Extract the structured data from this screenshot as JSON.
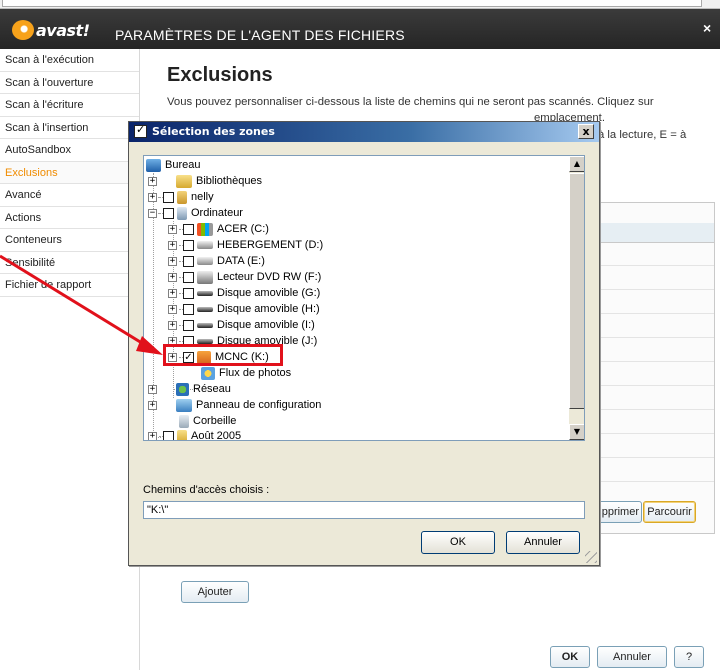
{
  "window": {
    "logo_text": "avast!",
    "title": "PARAMÈTRES DE L'AGENT DES FICHIERS",
    "close": "×"
  },
  "sidebar": {
    "items": [
      {
        "label": "Scan à l'exécution",
        "active": false
      },
      {
        "label": "Scan à l'ouverture",
        "active": false
      },
      {
        "label": "Scan à l'écriture",
        "active": false
      },
      {
        "label": "Scan à l'insertion",
        "active": false
      },
      {
        "label": "AutoSandbox",
        "active": false
      },
      {
        "label": "Exclusions",
        "active": true
      },
      {
        "label": "Avancé",
        "active": false
      },
      {
        "label": "Actions",
        "active": false
      },
      {
        "label": "Conteneurs",
        "active": false
      },
      {
        "label": "Sensibilité",
        "active": false
      },
      {
        "label": "Fichier de rapport",
        "active": false
      }
    ],
    "active_color": "#f08c00"
  },
  "main": {
    "heading": "Exclusions",
    "desc_line1": "Vous pouvez personnaliser ci-dessous la liste de chemins qui ne seront pas scannés. Cliquez sur",
    "desc_line2_fragment": "emplacement.",
    "desc_line3_fragment": "à la lecture, E = à",
    "buttons": {
      "supprimer": "pprimer",
      "parcourir": "Parcourir",
      "ajouter": "Ajouter",
      "ok": "OK",
      "annuler": "Annuler",
      "help": "?"
    }
  },
  "dialog": {
    "title": "Sélection des zones",
    "close": "x",
    "tree": [
      {
        "label": "Bureau",
        "icon": "desktop-icon"
      },
      {
        "label": "Bibliothèques",
        "icon": "libraries-icon"
      },
      {
        "label": "nelly",
        "icon": "user-folder-icon"
      },
      {
        "label": "Ordinateur",
        "icon": "computer-icon"
      },
      {
        "label": "ACER (C:)",
        "icon": "windows-drive-icon"
      },
      {
        "label": "HEBERGEMENT (D:)",
        "icon": "hard-drive-icon"
      },
      {
        "label": "DATA (E:)",
        "icon": "hard-drive-icon"
      },
      {
        "label": "Lecteur DVD RW (F:)",
        "icon": "dvd-drive-icon"
      },
      {
        "label": "Disque amovible (G:)",
        "icon": "removable-drive-icon"
      },
      {
        "label": "Disque amovible (H:)",
        "icon": "removable-drive-icon"
      },
      {
        "label": "Disque amovible (I:)",
        "icon": "removable-drive-icon"
      },
      {
        "label": "Disque amovible (J:)",
        "icon": "removable-drive-icon"
      },
      {
        "label": "MCNC (K:)",
        "icon": "locked-drive-icon",
        "checked": true
      },
      {
        "label": "Flux de photos",
        "icon": "photo-stream-icon"
      },
      {
        "label": "Réseau",
        "icon": "network-icon"
      },
      {
        "label": "Panneau de configuration",
        "icon": "control-panel-icon"
      },
      {
        "label": "Corbeille",
        "icon": "recycle-bin-icon"
      },
      {
        "label": "Août 2005",
        "icon": "folder-icon"
      }
    ],
    "paths_label": "Chemins d'accès choisis :",
    "paths_value": "\"K:\\\"",
    "ok": "OK",
    "cancel": "Annuler",
    "highlight_color": "#e1111b"
  }
}
